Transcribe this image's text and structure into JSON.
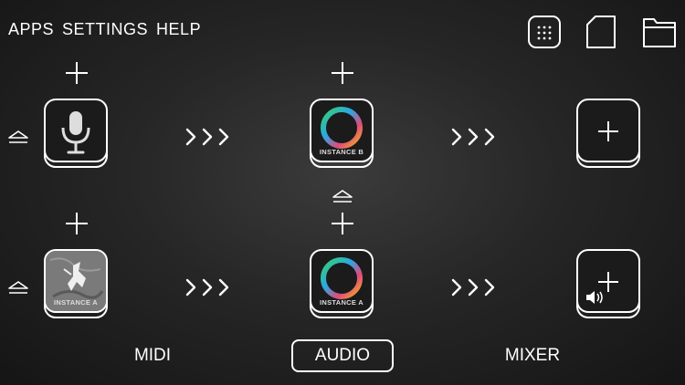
{
  "menu": {
    "apps": "APPS",
    "settings": "SETTINGS",
    "help": "HELP"
  },
  "top_icons": [
    "grid-icon",
    "document-icon",
    "folder-icon"
  ],
  "rows": [
    {
      "midi": {
        "icon": "microphone-icon",
        "label": ""
      },
      "audio": {
        "icon": "color-ring-icon",
        "label": "INSTANCE B"
      },
      "mixer": {
        "icon": "plus-icon",
        "label": ""
      }
    },
    {
      "midi": {
        "icon": "ancient-artwork-icon",
        "label": "INSTANCE A"
      },
      "audio": {
        "icon": "color-ring-icon",
        "label": "INSTANCE A"
      },
      "mixer": {
        "icon": "plus-speaker-icon",
        "label": ""
      }
    }
  ],
  "tabs": {
    "midi": "MIDI",
    "audio": "AUDIO",
    "mixer": "MIXER",
    "active": "AUDIO"
  },
  "colors": {
    "background": "#262626",
    "foreground": "#ffffff"
  }
}
